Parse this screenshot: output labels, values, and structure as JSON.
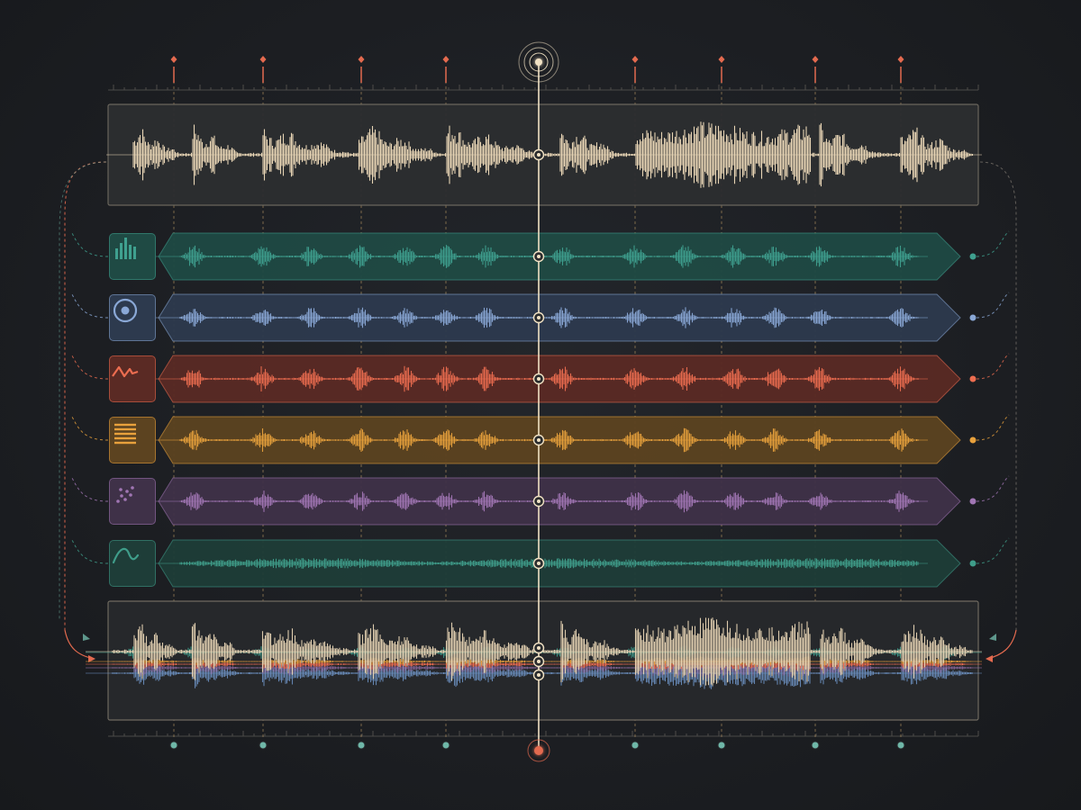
{
  "colors": {
    "background": "#1c1e22",
    "source": "#e8d5b5",
    "playhead": "#f1e2c4",
    "marker": "#e36a4f",
    "guide": "#c9a46a",
    "mix_frame": "#c9a46a"
  },
  "timeline": {
    "markers": 9,
    "bottom_markers": 9,
    "playhead_fraction": 0.5
  },
  "source_track": {
    "icon": "waveform",
    "level": 0.95
  },
  "stems": [
    {
      "id": "bars",
      "icon": "bar-chart-icon",
      "color": "#3fa08f",
      "fill": "#1f4a44",
      "level": 0.55
    },
    {
      "id": "target",
      "icon": "target-icon",
      "color": "#8aa8d6",
      "fill": "#2d3a4e",
      "level": 0.5
    },
    {
      "id": "zigzag",
      "icon": "zigzag-icon",
      "color": "#ec6d50",
      "fill": "#5a2a24",
      "level": 0.6
    },
    {
      "id": "lines",
      "icon": "lines-icon",
      "color": "#e8a13c",
      "fill": "#5c4320",
      "level": 0.55
    },
    {
      "id": "dots",
      "icon": "scatter-dots-icon",
      "color": "#a176b4",
      "fill": "#3f3148",
      "level": 0.5
    },
    {
      "id": "curve",
      "icon": "sine-curve-icon",
      "color": "#3f9d8a",
      "fill": "#1e3d38",
      "level": 0.3
    }
  ],
  "mix_track": {
    "icon": "combined-waveform",
    "level": 1.0
  }
}
